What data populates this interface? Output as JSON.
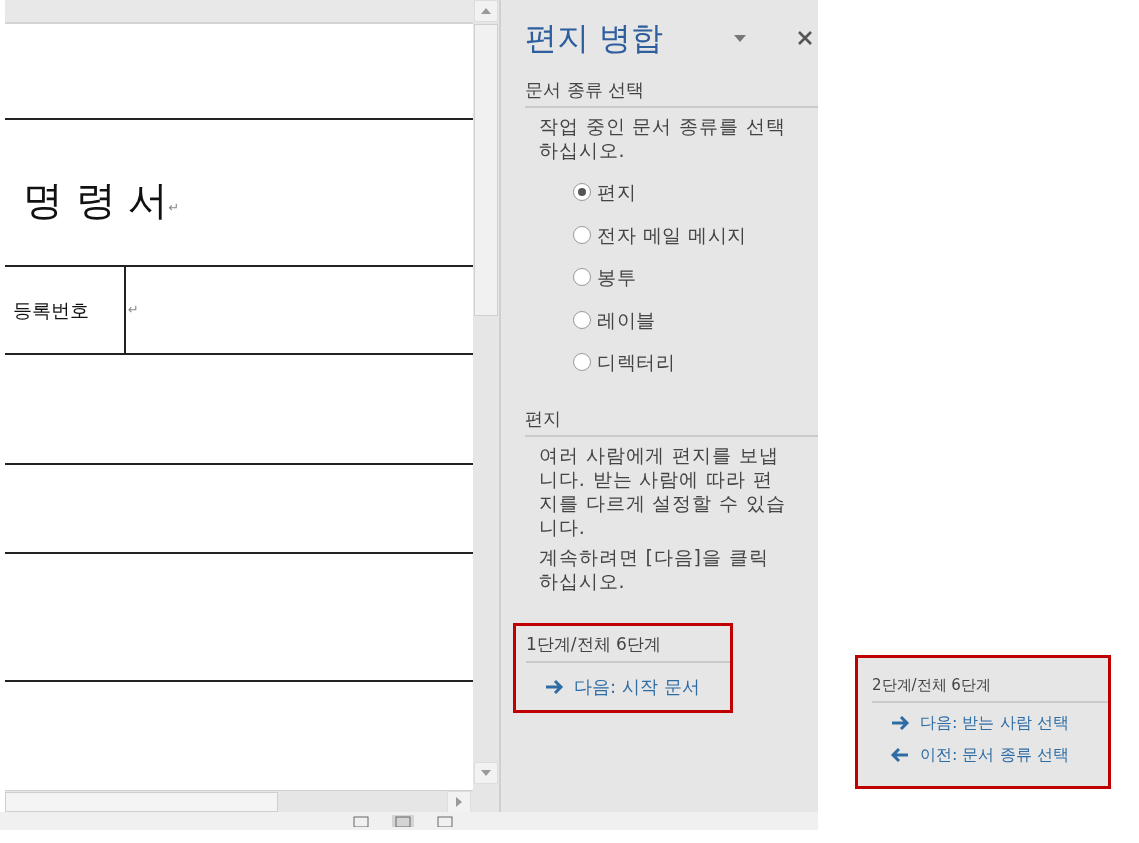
{
  "document": {
    "title": "명 령 서",
    "title_mark": "↵",
    "table_row": {
      "label": "등록번호",
      "mark": "↵"
    }
  },
  "task_pane": {
    "title": "편지 병합",
    "sections": [
      {
        "heading": "문서 종류 선택",
        "paragraphs": [
          "작업 중인 문서 종류를 선택하십시오."
        ],
        "options": [
          {
            "label": "편지",
            "selected": true
          },
          {
            "label": "전자 메일 메시지",
            "selected": false
          },
          {
            "label": "봉투",
            "selected": false
          },
          {
            "label": "레이블",
            "selected": false
          },
          {
            "label": "디렉터리",
            "selected": false
          }
        ]
      },
      {
        "heading": "편지",
        "paragraphs": [
          "여러 사람에게 편지를 보냅니다. 받는 사람에 따라 편지를 다르게 설정할 수 있습니다.",
          "계속하려면 [다음]을 클릭하십시오."
        ]
      }
    ],
    "step": {
      "text": "1단계/전체 6단계",
      "links": [
        {
          "kind": "next",
          "label": "다음: 시작 문서"
        }
      ]
    }
  },
  "inset_step": {
    "text": "2단계/전체 6단계",
    "links": [
      {
        "kind": "next",
        "label": "다음: 받는 사람 선택"
      },
      {
        "kind": "prev",
        "label": "이전: 문서 종류 선택"
      }
    ]
  }
}
